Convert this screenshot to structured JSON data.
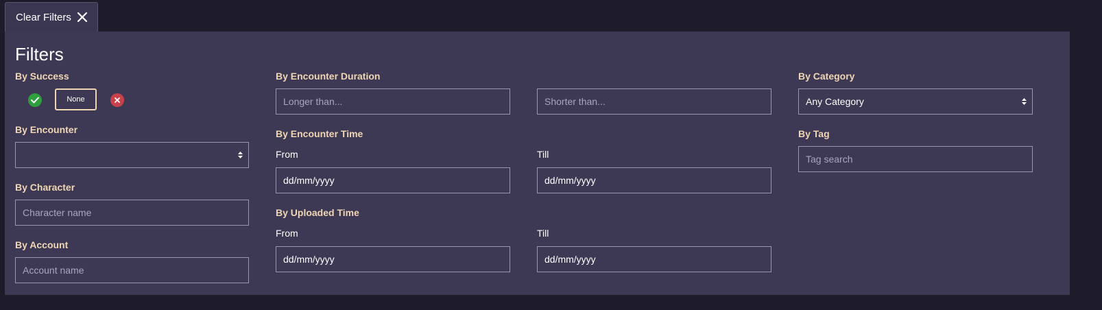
{
  "tab": {
    "clear_filters_label": "Clear Filters",
    "close_icon": "close-icon"
  },
  "filters": {
    "title": "Filters",
    "success": {
      "label": "By Success",
      "success_icon": "check-circle-icon",
      "none_label": "None",
      "failure_icon": "x-circle-icon",
      "colors": {
        "success": "#2e9e3e",
        "failure": "#c8414b",
        "active_border": "#f0d6b3"
      }
    },
    "encounter": {
      "label": "By Encounter",
      "value": ""
    },
    "character": {
      "label": "By Character",
      "placeholder": "Character name"
    },
    "account": {
      "label": "By Account",
      "placeholder": "Account name"
    },
    "duration": {
      "label": "By Encounter Duration",
      "longer_placeholder": "Longer than...",
      "shorter_placeholder": "Shorter than..."
    },
    "encounter_time": {
      "label": "By Encounter Time",
      "from_label": "From",
      "from_value": "dd/mm/yyyy",
      "till_label": "Till",
      "till_value": "dd/mm/yyyy"
    },
    "uploaded_time": {
      "label": "By Uploaded Time",
      "from_label": "From",
      "from_value": "dd/mm/yyyy",
      "till_label": "Till",
      "till_value": "dd/mm/yyyy"
    },
    "category": {
      "label": "By Category",
      "value": "Any Category"
    },
    "tag": {
      "label": "By Tag",
      "placeholder": "Tag search"
    }
  }
}
